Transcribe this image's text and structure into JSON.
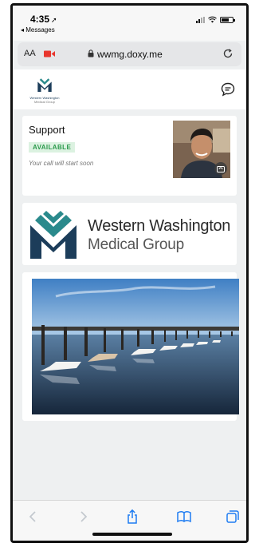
{
  "status_bar": {
    "time": "4:35",
    "back_app": "◂ Messages"
  },
  "browser": {
    "aa_label": "AA",
    "url": "wwmg.doxy.me"
  },
  "support_card": {
    "title": "Support",
    "status_badge": "AVAILABLE",
    "message": "Your call will start soon"
  },
  "small_logo": {
    "line1": "Western Washington",
    "line2": "Medical Group"
  },
  "brand": {
    "name": "Western Washington",
    "subtitle": "Medical Group"
  },
  "colors": {
    "brand_navy": "#1c3d5a",
    "brand_teal": "#2a8a8c",
    "badge_green": "#2b9a4c",
    "ios_blue": "#1e7cf2",
    "record_red": "#e8362d"
  },
  "icons": [
    "back-arrow-icon",
    "forward-arrow-icon",
    "share-icon",
    "bookmarks-icon",
    "tabs-icon",
    "chat-bubble-icon",
    "camera-flip-icon",
    "lock-icon",
    "reload-icon",
    "video-camera-icon"
  ]
}
